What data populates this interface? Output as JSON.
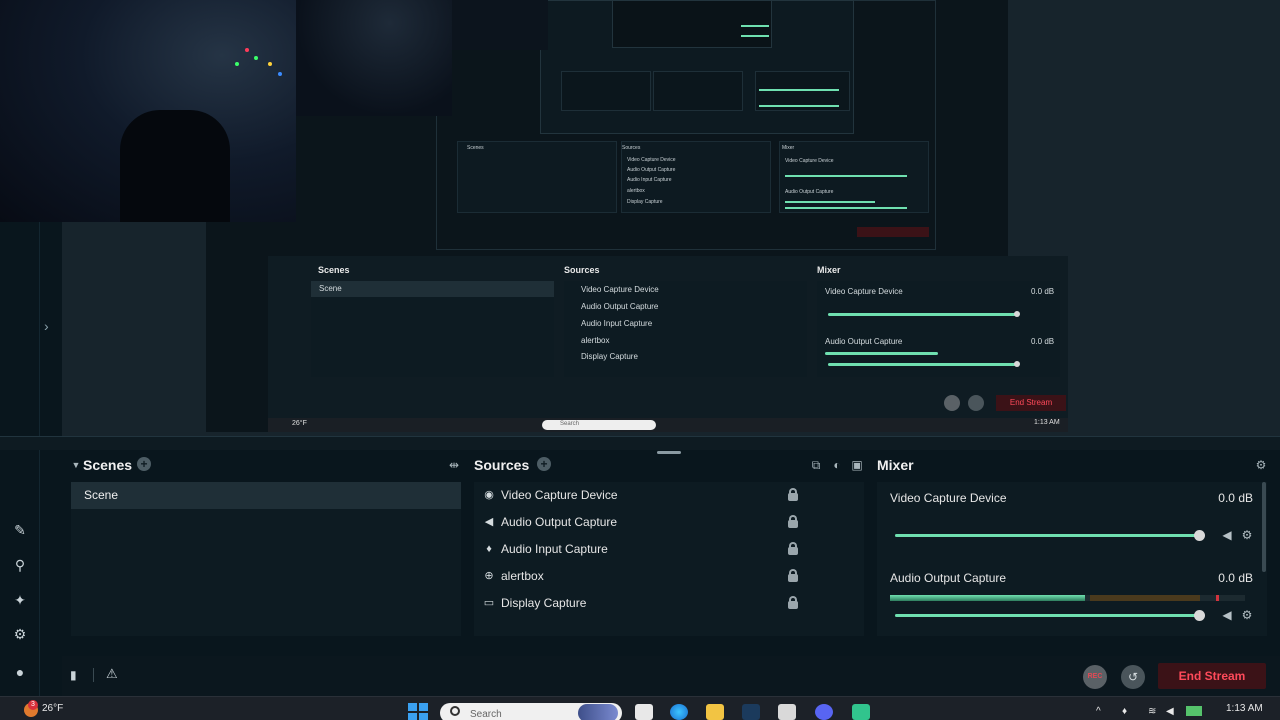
{
  "preview": {
    "mid": {
      "scenes_title": "Scenes",
      "scene_item": "Scene",
      "sources_title": "Sources",
      "sources": [
        "Video Capture Device",
        "Audio Output Capture",
        "Audio Input Capture",
        "alertbox",
        "Display Capture"
      ],
      "mixer_title": "Mixer",
      "mixer": [
        {
          "name": "Video Capture Device",
          "db": "0.0 dB"
        },
        {
          "name": "Audio Output Capture",
          "db": "0.0 dB"
        }
      ],
      "end_stream": "End Stream",
      "weather": "26°F",
      "time": "1:13 AM",
      "search_placeholder": "Search"
    }
  },
  "scenes": {
    "title": "Scenes",
    "items": [
      "Scene"
    ]
  },
  "sources": {
    "title": "Sources",
    "items": [
      {
        "label": "Video Capture Device",
        "icon": "webcam-icon"
      },
      {
        "label": "Audio Output Capture",
        "icon": "speaker-icon"
      },
      {
        "label": "Audio Input Capture",
        "icon": "microphone-icon"
      },
      {
        "label": "alertbox",
        "icon": "globe-icon"
      },
      {
        "label": "Display Capture",
        "icon": "monitor-icon"
      }
    ]
  },
  "mixer": {
    "title": "Mixer",
    "tracks": [
      {
        "name": "Video Capture Device",
        "db": "0.0 dB",
        "volume": 1.0,
        "level": 0.0
      },
      {
        "name": "Audio Output Capture",
        "db": "0.0 dB",
        "volume": 1.0,
        "level": 0.55
      }
    ]
  },
  "controls": {
    "rec_label": "REC",
    "end_stream": "End Stream",
    "accent_red": "#ff4a5a",
    "accent_green": "#6fe0b0"
  },
  "taskbar": {
    "weather_temp": "26°F",
    "weather_badge": "3",
    "search_placeholder": "Search",
    "time": "1:13 AM"
  }
}
